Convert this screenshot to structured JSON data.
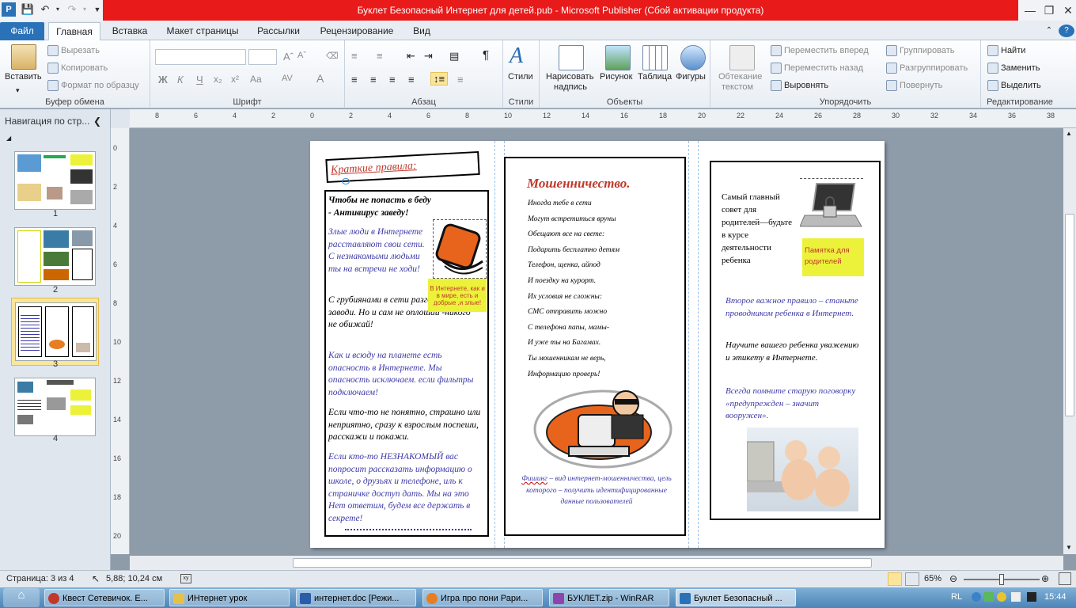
{
  "window": {
    "title": "Буклет Безопасный Интернет для детей.pub  -  Microsoft Publisher (Сбой активации продукта)"
  },
  "tabs": [
    "Файл",
    "Главная",
    "Вставка",
    "Макет страницы",
    "Рассылки",
    "Рецензирование",
    "Вид"
  ],
  "ribbon": {
    "clipboard": {
      "paste": "Вставить",
      "cut": "Вырезать",
      "copy": "Копировать",
      "format_painter": "Формат по образцу",
      "label": "Буфер обмена"
    },
    "font": {
      "label": "Шрифт"
    },
    "paragraph": {
      "label": "Абзац"
    },
    "styles": {
      "button": "Стили",
      "label": "Стили"
    },
    "objects": {
      "draw_textbox_1": "Нарисовать",
      "draw_textbox_2": "надпись",
      "picture": "Рисунок",
      "table": "Таблица",
      "shapes": "Фигуры",
      "label": "Объекты"
    },
    "arrange": {
      "wrap_1": "Обтекание",
      "wrap_2": "текстом",
      "bring_forward": "Переместить вперед",
      "send_backward": "Переместить назад",
      "align": "Выровнять",
      "group": "Группировать",
      "ungroup": "Разгруппировать",
      "rotate": "Повернуть",
      "label": "Упорядочить"
    },
    "editing": {
      "find": "Найти",
      "replace": "Заменить",
      "select": "Выделить",
      "label": "Редактирование"
    }
  },
  "nav": {
    "title": "Навигация по стр...",
    "pages": [
      "1",
      "2",
      "3",
      "4"
    ],
    "selected": "3"
  },
  "ruler": {
    "h_ticks": [
      "8",
      "6",
      "4",
      "2",
      "0",
      "2",
      "4",
      "6",
      "8",
      "10",
      "12",
      "14",
      "16",
      "18",
      "20",
      "22",
      "24",
      "26",
      "28",
      "30",
      "32",
      "34",
      "36",
      "38"
    ],
    "v_ticks": [
      "0",
      "2",
      "4",
      "6",
      "8",
      "10",
      "12",
      "14",
      "16",
      "18",
      "20"
    ]
  },
  "panel1": {
    "header": "Краткие правила:",
    "p1": "Чтобы не попасть в беду - Антивирус заведу!",
    "p2": "Злые люди в Интернете расставляют свои сети. С незнакомыми людьми ты на встречи не ходи!",
    "p3": "С грубиянами в сети разговор не заводи. Но и сам не оплошай -никого не обижай!",
    "p4": "Как и всюду на планете есть опасность в Интернете. Мы опасность исключаем. если фильтры подключаем!",
    "p5": "Если что-то не понятно, страшно или неприятно, сразу к взрослым поспеши, расскажи и покажи.",
    "p6": "Если кто-то НЕЗНАКОМЫЙ вас попросит рассказать информацию о школе, о друзьях и телефоне, иль к страничке доступ дать. Мы на это Нет ответим, будем все держать в секрете!",
    "callout": "В Интернете, как и в мире, есть и добрые ,и злые!"
  },
  "panel2": {
    "title": "Мошенничество.",
    "lines": [
      "Иногда тебе в сети",
      "Могут встретиться вруны",
      "Обещают все на свете:",
      "Подарить бесплатно детям",
      "Телефон, щенка, айпод",
      "И поездку на курорт.",
      "Их условия не сложны:",
      "СМС отправить можно",
      "С телефона папы, мамы-",
      "И уже ты на Багамах.",
      "Ты мошенникам не верь,",
      "Информацию проверь!"
    ],
    "phishing_term": "Фишинг",
    "phishing_def": " – вид интернет-мошенничества, цель которого – получить идентифицированные данные пользователей"
  },
  "panel3": {
    "p1": "Самый главный совет для родителей—будьте в курсе деятельности ребенка",
    "memo": "Памятка для родителей",
    "p2": "Второе важное правило – станьте проводником ребенка в Интернет.",
    "p3": "Научите вашего ребенка уважению и этикету в Интернете.",
    "p4": "Всегда помните старую поговорку «предупрежден – значит вооружен»."
  },
  "status": {
    "page": "Страница: 3 из 4",
    "position": "5,88; 10,24 см",
    "zoom": "65%",
    "zoom_level": 0.65
  },
  "taskbar": {
    "items": [
      "Квест Сетевичок. Е...",
      "ИНтернет урок",
      "интернет.doc [Режи...",
      "Игра про пони Рари...",
      "БУКЛЕТ.zip - WinRAR",
      "Буклет Безопасный ..."
    ],
    "lang": "RL",
    "time": "15:44"
  },
  "colors": {
    "title_bar": "#e81a1a",
    "file_tab": "#2a72b8",
    "heading_red": "#c0392b",
    "body_blue": "#3d3aa8",
    "callout_yellow": "#ecf23a"
  }
}
